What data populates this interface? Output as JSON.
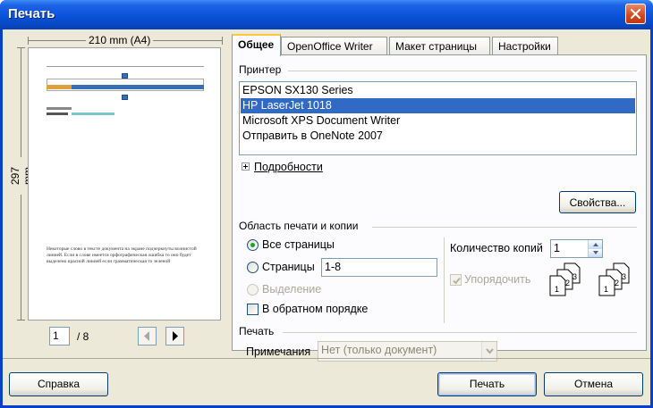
{
  "window": {
    "title": "Печать",
    "close_icon": "close-icon"
  },
  "preview": {
    "width_label": "210 mm (A4)",
    "height_label": "297 mm",
    "current_page": "1",
    "total_pages": "/ 8",
    "page_small_text": "Некоторые слово в тексте документа на экране подчеркнуты волнистой линией. Если в слове имеется орфографическая ошибка то оно будет выделено красной линией если грамматическая то зеленой"
  },
  "tabs": [
    {
      "label": "Общее",
      "active": true
    },
    {
      "label": "OpenOffice Writer"
    },
    {
      "label": "Макет страницы"
    },
    {
      "label": "Настройки"
    }
  ],
  "printer": {
    "group_label": "Принтер",
    "items": [
      {
        "label": "EPSON SX130 Series"
      },
      {
        "label": "HP LaserJet 1018",
        "selected": true
      },
      {
        "label": "Microsoft XPS Document Writer"
      },
      {
        "label": "Отправить в OneNote 2007"
      }
    ],
    "details_label": "Подробности",
    "properties_button": "Свойства..."
  },
  "range": {
    "group_label": "Область печати и копии",
    "all_pages": "Все страницы",
    "pages": "Страницы",
    "pages_value": "1-8",
    "selection": "Выделение",
    "reverse": "В обратном порядке",
    "copies_label": "Количество копий",
    "copies_value": "1",
    "collate": "Упорядочить"
  },
  "print": {
    "group_label": "Печать",
    "notes_label": "Примечания",
    "notes_value": "Нет (только документ)"
  },
  "buttons": {
    "help": "Справка",
    "print": "Печать",
    "cancel": "Отмена"
  },
  "colors": {
    "title_bar": "#0a52d9",
    "selection": "#316ac5",
    "face": "#ece9d8"
  }
}
